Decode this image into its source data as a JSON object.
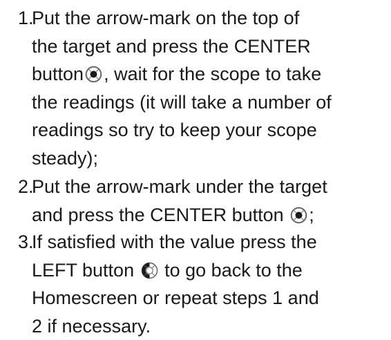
{
  "steps": [
    {
      "number": "1.",
      "lines": [
        "Put the arrow-mark on the top of",
        "the target and press the CENTER",
        "button",
        ", wait for the scope to take",
        "the readings (it will take a number of",
        "readings so try to keep your scope",
        "steady);"
      ],
      "icon": "center-button-icon"
    },
    {
      "number": "2.",
      "lines": [
        "Put the arrow-mark under the target",
        "and press the CENTER button",
        ";"
      ],
      "icon": "center-button-icon"
    },
    {
      "number": "3.",
      "lines": [
        "If satisfied with the value press the",
        "LEFT button",
        "to go back to the",
        "Homescreen or repeat steps 1 and",
        "2 if necessary."
      ],
      "icon": "left-button-icon"
    }
  ]
}
